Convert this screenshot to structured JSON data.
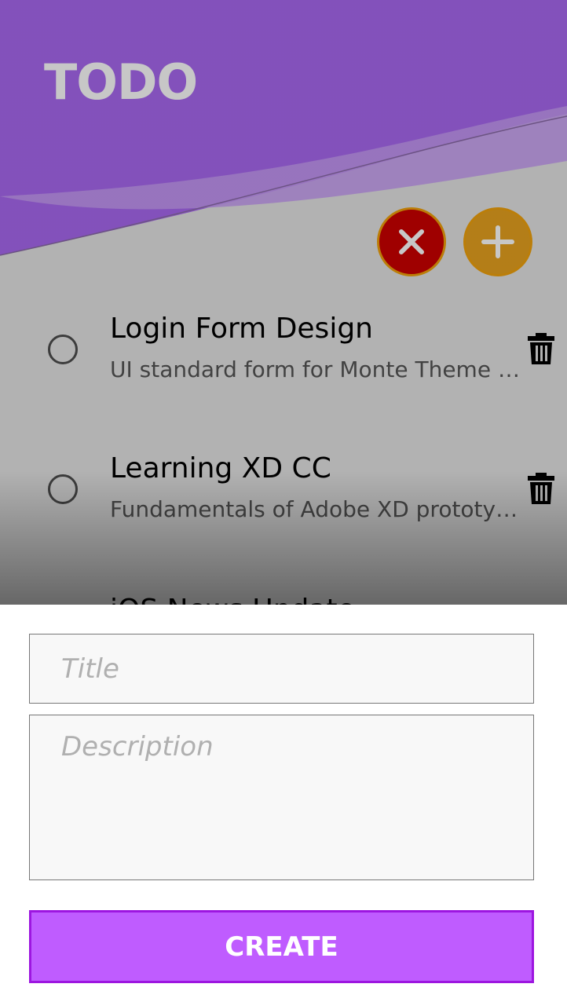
{
  "app": {
    "title": "TODO",
    "accent": "#b461ff",
    "close_color": "#cc0000",
    "add_color": "#e6a11f"
  },
  "actions": {
    "close_icon": "close-icon",
    "add_icon": "plus-icon"
  },
  "todos": [
    {
      "title": "Login Form Design",
      "description": "UI standard form for Monte Theme with animation",
      "completed": false
    },
    {
      "title": "Learning XD CC",
      "description": "Fundamentals of Adobe XD prototyping",
      "completed": false
    },
    {
      "title": "iOS News Update",
      "description": "",
      "completed": false
    }
  ],
  "form": {
    "title_placeholder": "Title",
    "title_value": "",
    "description_placeholder": "Description",
    "description_value": "",
    "create_label": "CREATE"
  }
}
